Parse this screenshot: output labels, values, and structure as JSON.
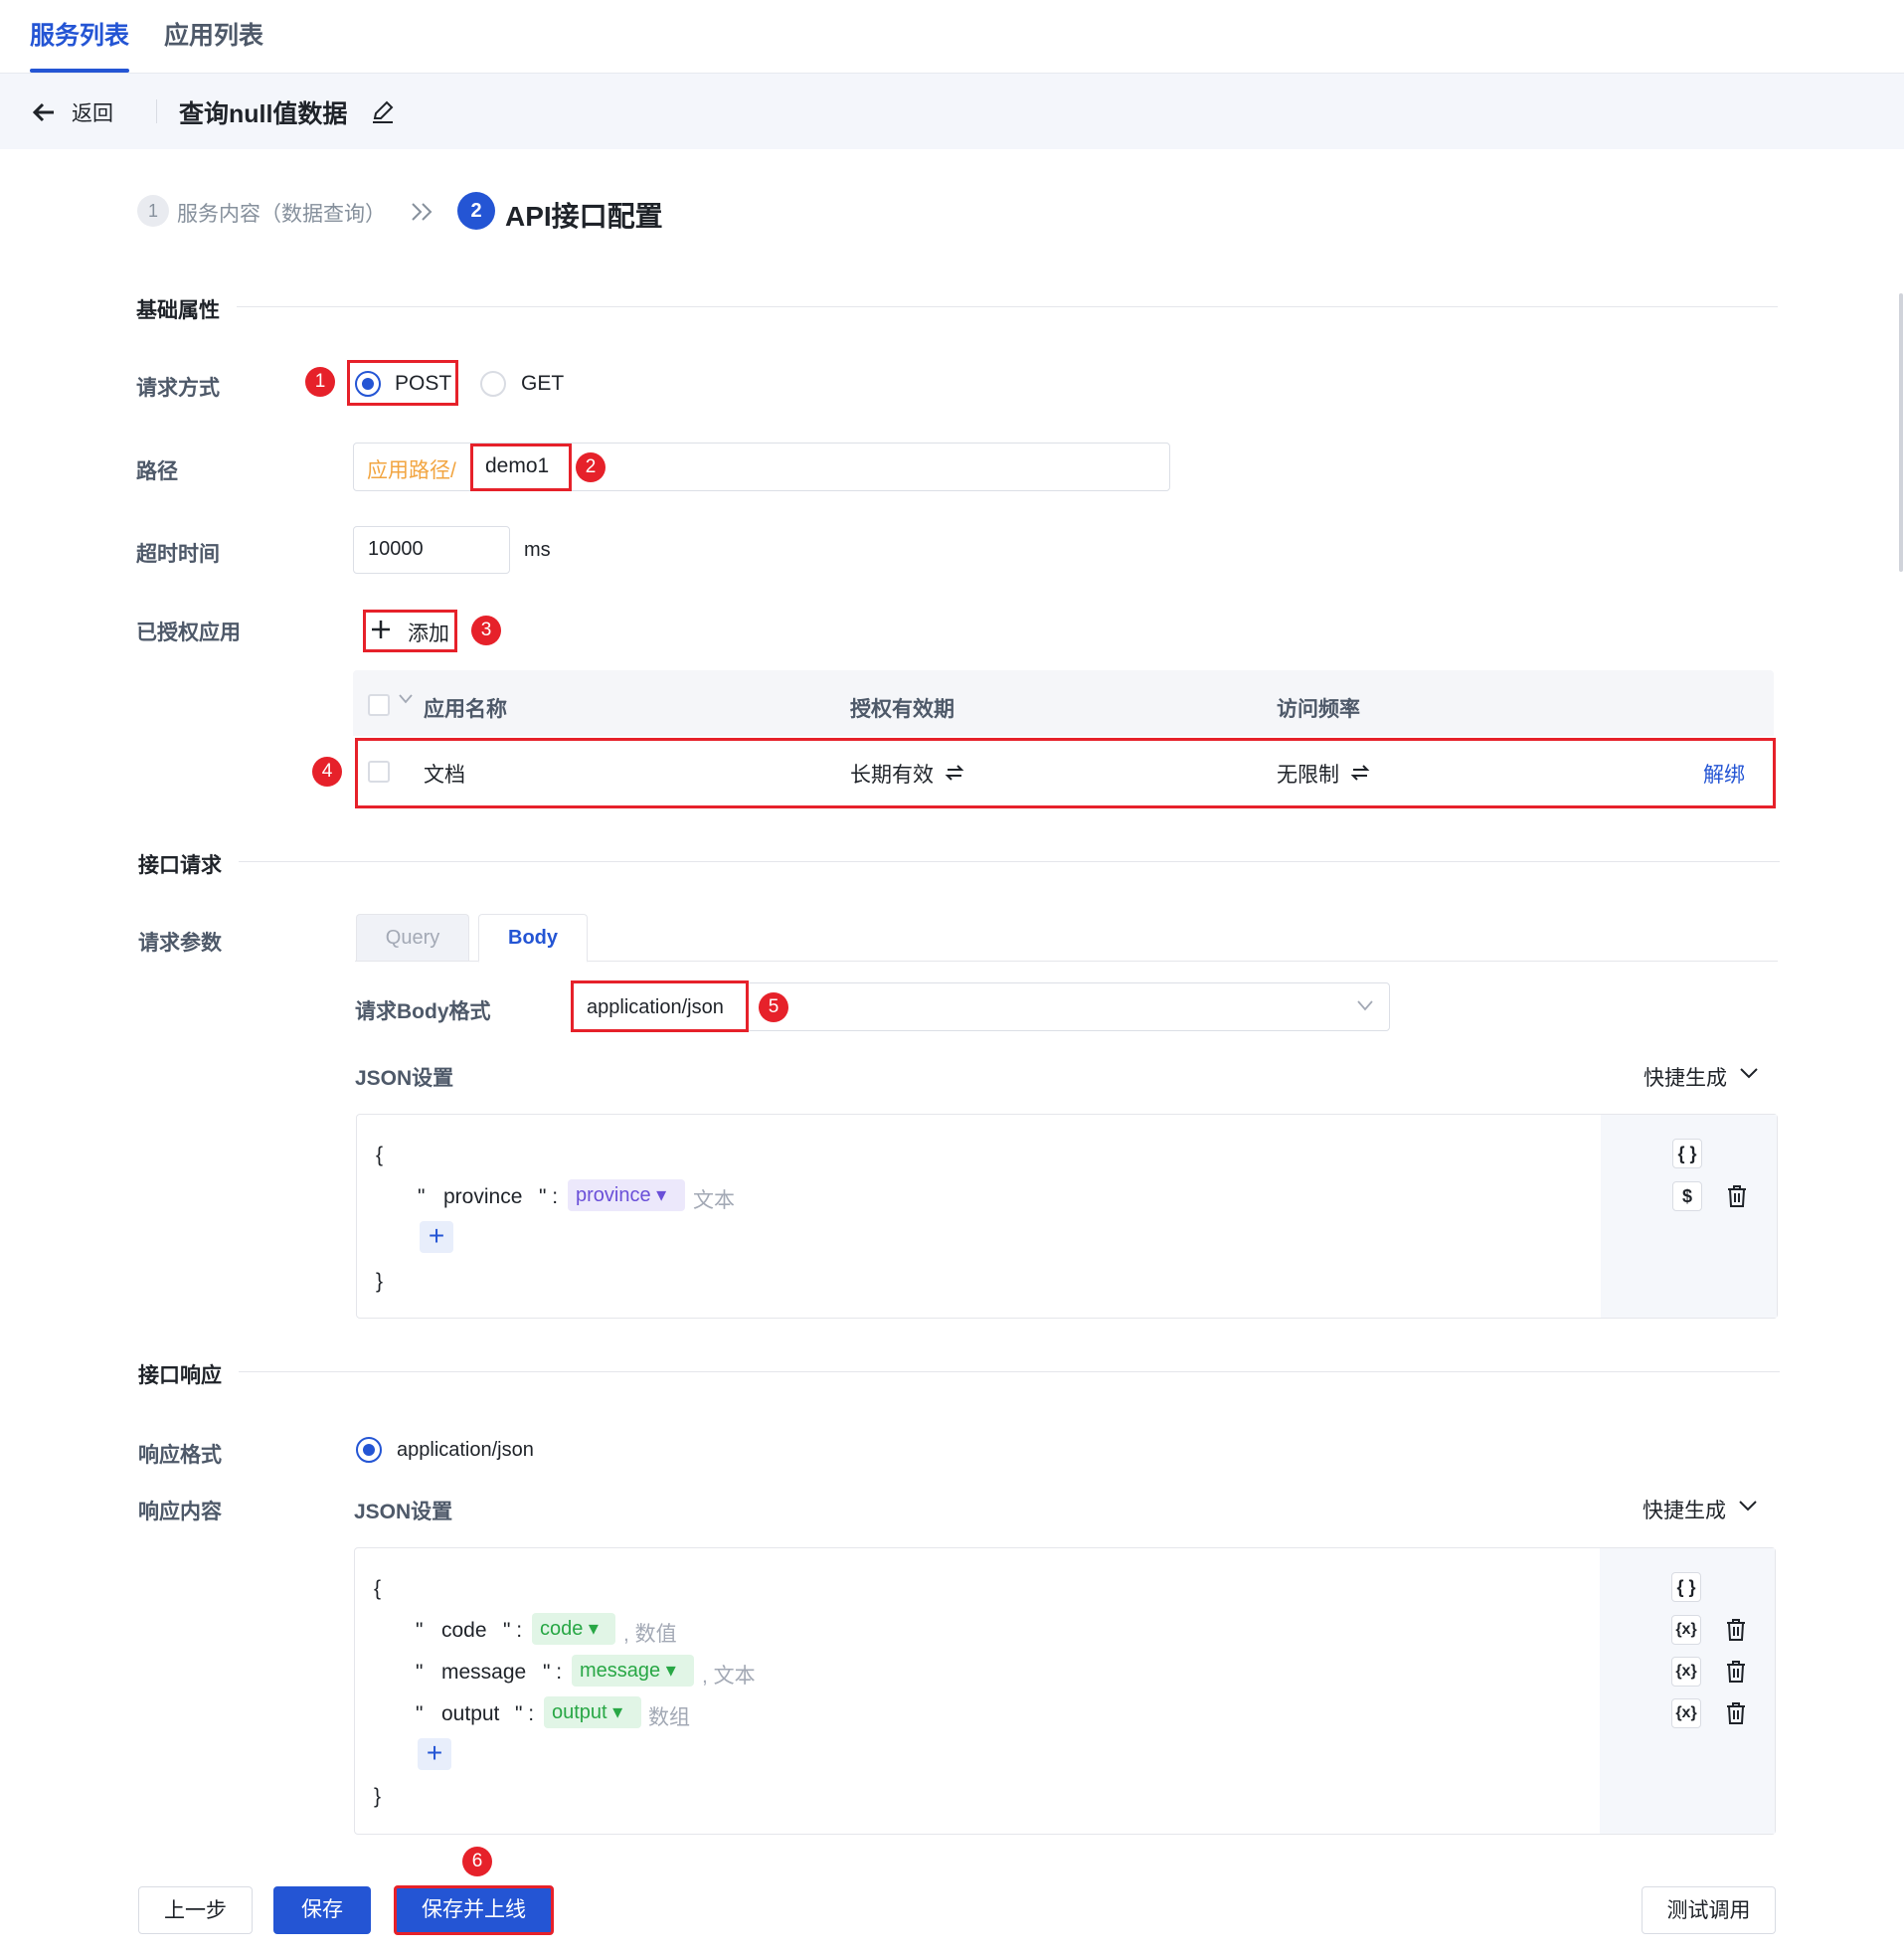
{
  "top_tabs": [
    {
      "label": "服务列表"
    },
    {
      "label": "应用列表"
    }
  ],
  "header": {
    "back_label": "返回",
    "title": "查询null值数据"
  },
  "steps": [
    {
      "num": "1",
      "label": "服务内容（数据查询）"
    },
    {
      "num": "2",
      "label": "API接口配置"
    }
  ],
  "basic": {
    "section_title": "基础属性",
    "method_label": "请求方式",
    "method_options": [
      "POST",
      "GET"
    ],
    "method_selected": "POST",
    "path_label": "路径",
    "path_prefix": "应用路径/",
    "path_value": "demo1",
    "timeout_label": "超时时间",
    "timeout_value": "10000",
    "timeout_unit": "ms",
    "auth_label": "已授权应用",
    "add_label": "添加"
  },
  "auth_table": {
    "headers": [
      "应用名称",
      "授权有效期",
      "访问频率"
    ],
    "rows": [
      {
        "name": "文档",
        "validity": "长期有效",
        "rate": "无限制",
        "action": "解绑"
      }
    ]
  },
  "request": {
    "section_title": "接口请求",
    "params_label": "请求参数",
    "tabs": [
      "Query",
      "Body"
    ],
    "active_tab": "Body",
    "body_format_label": "请求Body格式",
    "body_format_value": "application/json",
    "json_label": "JSON设置",
    "quick_gen": "快捷生成",
    "json_open": "{",
    "json_close": "}",
    "fields": [
      {
        "key": "province",
        "tag": "province",
        "type": "文本"
      }
    ]
  },
  "response": {
    "section_title": "接口响应",
    "format_label": "响应格式",
    "format_value": "application/json",
    "content_label": "响应内容",
    "json_label": "JSON设置",
    "quick_gen": "快捷生成",
    "json_open": "{",
    "json_close": "}",
    "fields": [
      {
        "key": "code",
        "tag": "code",
        "type": "数值"
      },
      {
        "key": "message",
        "tag": "message",
        "type": "文本"
      },
      {
        "key": "output",
        "tag": "output",
        "type": "数组"
      }
    ]
  },
  "footer": {
    "prev": "上一步",
    "save": "保存",
    "save_online": "保存并上线",
    "test": "测试调用"
  },
  "annotations": [
    "1",
    "2",
    "3",
    "4",
    "5",
    "6"
  ],
  "icons": {
    "object": "{ }",
    "dollar": "$",
    "variable": "{x}"
  },
  "colors": {
    "primary": "#2455d4",
    "annotation": "#e6212a",
    "path_prefix": "#f2a541"
  }
}
